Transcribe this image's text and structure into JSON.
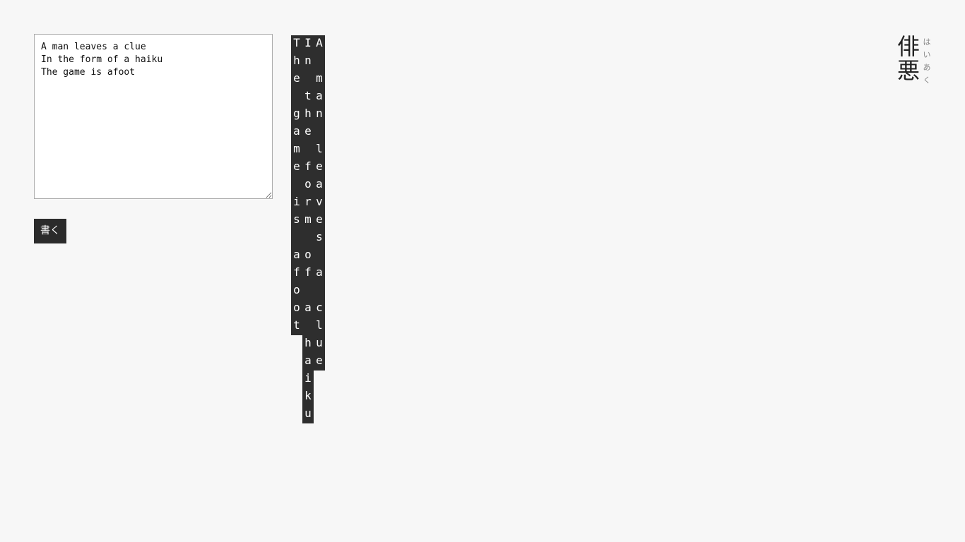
{
  "input": {
    "text": "A man leaves a clue\nIn the form of a haiku\nThe game is afoot"
  },
  "write_button": {
    "label": "書く"
  },
  "output": {
    "columns": [
      "A man leaves a clue",
      "In the form of a haiku",
      "The game is afoot"
    ]
  },
  "logo": {
    "kanji": [
      "俳",
      "悪"
    ],
    "kana": [
      "は",
      "い",
      "あ",
      "く"
    ]
  },
  "colors": {
    "background": "#f7f7f7",
    "column_bg": "#2e2e2e",
    "button_bg": "#2b2b2b"
  }
}
